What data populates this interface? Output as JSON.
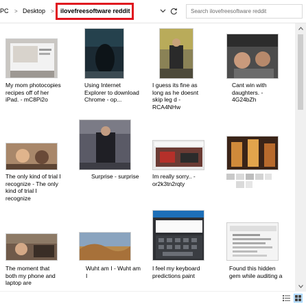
{
  "address": {
    "crumbs": [
      "PC",
      "Desktop",
      "ilovefreesoftware reddit"
    ],
    "separators": [
      ">",
      ">"
    ],
    "highlight_color": "#e0141e"
  },
  "search": {
    "placeholder": "Search ilovefreesoftware reddit"
  },
  "icons": {
    "dropdown": "chevron-down-icon",
    "refresh": "refresh-icon",
    "scroll_up": "scroll-up-icon",
    "scroll_down": "scroll-down-icon",
    "details_view": "details-view-icon",
    "large_icons_view": "large-icons-view-icon"
  },
  "files": [
    {
      "label": "My mom photocopies recipes off of her iPad. - mC8Pi2o",
      "thumb": "photo"
    },
    {
      "label": "Using Internet Explorer to download Chrome - op...",
      "thumb": "photo"
    },
    {
      "label": "I guess its fine as long as he doesnt skip leg d - RCA4NHw",
      "thumb": "photo"
    },
    {
      "label": "Cant win with daughters. - 4G24bZh",
      "thumb": "photo"
    },
    {
      "label": "The only kind of trial I recognize - The only kind of trial I recognize",
      "thumb": "photo"
    },
    {
      "label": "Surprise - surprise",
      "thumb": "photo"
    },
    {
      "label": "Im really sorry.. - or2k3tn2rqty",
      "thumb": "photo"
    },
    {
      "label": "",
      "thumb": "photo"
    },
    {
      "label": "The moment that both my phone and laptop are",
      "thumb": "photo"
    },
    {
      "label": "Wuht am I - Wuht am I",
      "thumb": "photo"
    },
    {
      "label": "I feel my keyboard predictions paint",
      "thumb": "photo"
    },
    {
      "label": "Found this hidden gem while auditing a",
      "thumb": "photo"
    }
  ]
}
